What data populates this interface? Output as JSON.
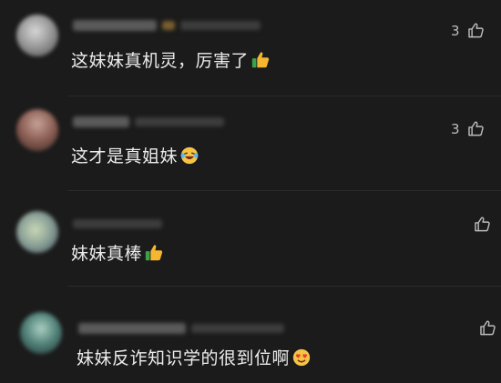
{
  "comments": [
    {
      "text": "这妹妹真机灵，厉害了",
      "emoji": "thumbs-up",
      "likes": "3"
    },
    {
      "text": "这才是真姐妹",
      "emoji": "laughing-crying-face",
      "likes": "3"
    },
    {
      "text": "妹妹真棒",
      "emoji": "thumbs-up",
      "likes": ""
    },
    {
      "text": "妹妹反诈知识学的很到位啊",
      "emoji": "heart-eyes-face",
      "likes": ""
    }
  ],
  "colors": {
    "background": "#1b1b1b",
    "text": "#ececec",
    "icon": "#bdbdbd"
  }
}
